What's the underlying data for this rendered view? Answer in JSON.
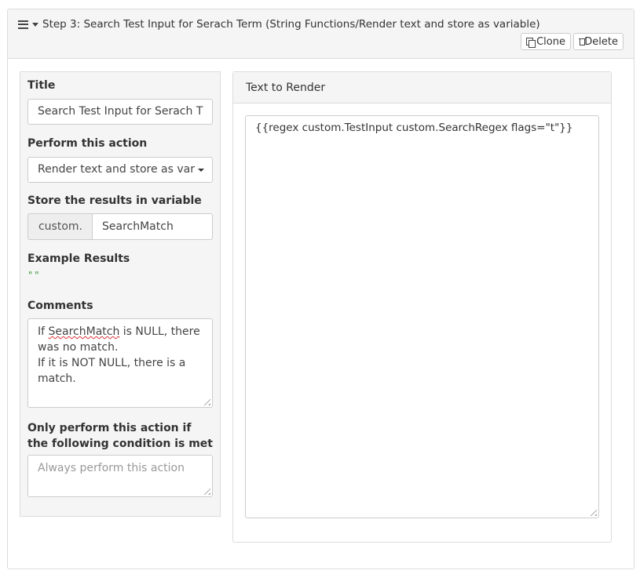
{
  "header": {
    "step_title": "Step 3: Search Test Input for Serach Term (String Functions/Render text and store as variable)",
    "clone_label": "Clone",
    "delete_label": "Delete"
  },
  "form": {
    "title_label": "Title",
    "title_value": "Search Test Input for Serach T",
    "action_label": "Perform this action",
    "action_value": "Render text and store as var",
    "store_label": "Store the results in variable",
    "store_prefix": "custom.",
    "store_value": "SearchMatch",
    "example_label": "Example Results",
    "example_value": "\"\"",
    "comments_label": "Comments",
    "comments_line1_pre": "If ",
    "comments_line1_word": "SearchMatch",
    "comments_line1_post": " is NULL, there was no match.",
    "comments_line2": "If it is NOT NULL, there is a match.",
    "condition_label": "Only perform this action if the following condition is met",
    "condition_placeholder": "Always perform this action"
  },
  "render": {
    "heading": "Text to Render",
    "template": "{{regex custom.TestInput custom.SearchRegex flags=\"t\"}}"
  }
}
